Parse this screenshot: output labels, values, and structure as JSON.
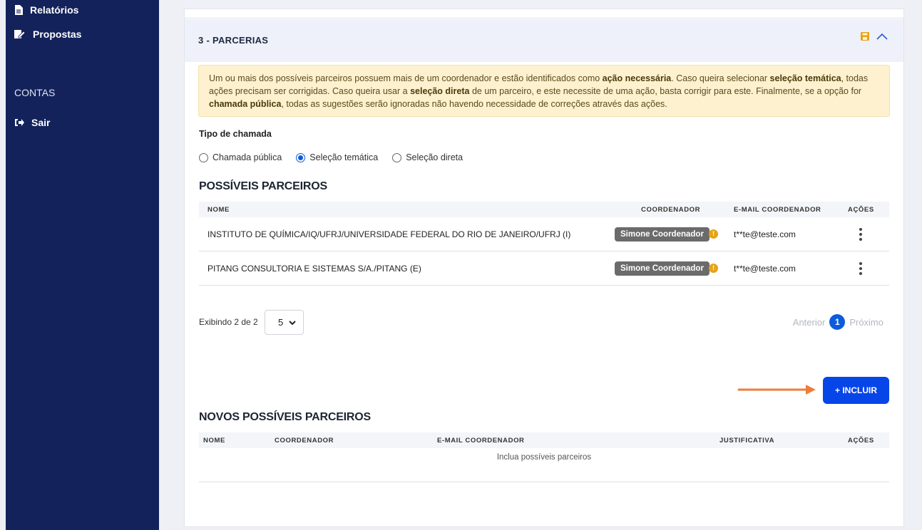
{
  "sidebar": {
    "items": [
      {
        "label": "Relatórios"
      },
      {
        "label": "Propostas"
      }
    ],
    "section_title": "CONTAS",
    "logout": {
      "label": "Sair"
    }
  },
  "panel": {
    "title": "3 - PARCERIAS",
    "alert": {
      "t1": "Um ou mais dos possíveis parceiros possuem mais de um coordenador e estão identificados como ",
      "b1": "ação necessária",
      "t2": ". Caso queira selecionar ",
      "b2": "seleção temática",
      "t3": ", todas ações precisam ser corrigidas. Caso queira usar a ",
      "b3": "seleção direta",
      "t4": " de um parceiro, e este necessite de uma ação, basta corrigir para este. Finalmente, se a opção for ",
      "b4": "chamada pública",
      "t5": ", todas as sugestões serão ignoradas não havendo necessidade de correções através das ações."
    },
    "tipo_chamada": {
      "label": "Tipo de chamada",
      "options": [
        "Chamada pública",
        "Seleção temática",
        "Seleção direta"
      ],
      "selected": "Seleção temática"
    }
  },
  "partners": {
    "title": "POSSÍVEIS PARCEIROS",
    "columns": {
      "nome": "NOME",
      "coordenador": "COORDENADOR",
      "email": "E-MAIL COORDENADOR",
      "acoes": "AÇÕES"
    },
    "rows": [
      {
        "nome": "INSTITUTO DE QUÍMICA/IQ/UFRJ/UNIVERSIDADE FEDERAL DO RIO DE JANEIRO/UFRJ (I)",
        "coordenador": "Simone Coordenador",
        "email": "t**te@teste.com"
      },
      {
        "nome": "PITANG CONSULTORIA E SISTEMAS S/A./PITANG (E)",
        "coordenador": "Simone Coordenador",
        "email": "t**te@teste.com"
      }
    ],
    "pagination": {
      "showing": "Exibindo 2 de 2",
      "page_size": "5",
      "prev": "Anterior",
      "current": "1",
      "next": "Próximo"
    }
  },
  "incluir_button": "+ INCLUIR",
  "new_partners": {
    "title": "NOVOS POSSÍVEIS PARCEIROS",
    "columns": {
      "nome": "NOME",
      "coordenador": "COORDENADOR",
      "email": "E-MAIL COORDENADOR",
      "justificativa": "JUSTIFICATIVA",
      "acoes": "AÇÕES"
    },
    "empty_message": "Inclua possíveis parceiros"
  },
  "colors": {
    "sidebar": "#13225a",
    "primary": "#0645e8",
    "alert_bg": "#fdf1cf",
    "warning": "#e6a316",
    "arrow": "#ee7c3a",
    "badge": "#6b6b6b"
  }
}
